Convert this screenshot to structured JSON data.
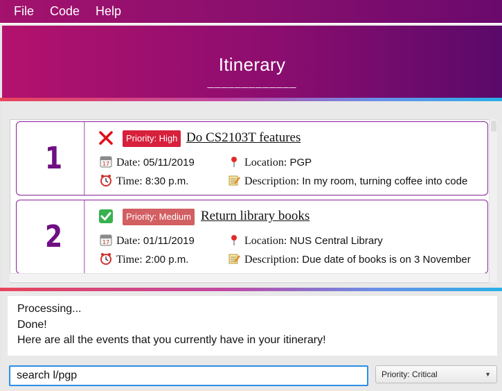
{
  "menu": {
    "file": "File",
    "code": "Code",
    "help": "Help"
  },
  "header": {
    "title": "Itinerary",
    "underline": "_____________"
  },
  "events": [
    {
      "index": "1",
      "status_icon": "cross-icon",
      "priority": "Priority: High",
      "title": "Do CS2103T features",
      "date_label": "Date:",
      "date": "05/11/2019",
      "time_label": "Time:",
      "time": "8:30 p.m.",
      "location_label": "Location:",
      "location": "PGP",
      "description_label": "Description:",
      "description": "In my room, turning coffee into code"
    },
    {
      "index": "2",
      "status_icon": "check-icon",
      "priority": "Priority: Medium",
      "title": "Return library books",
      "date_label": "Date:",
      "date": "01/11/2019",
      "time_label": "Time:",
      "time": "2:00 p.m.",
      "location_label": "Location:",
      "location": "NUS Central Library",
      "description_label": "Description:",
      "description": "Due date of books is on 3 November"
    }
  ],
  "result": {
    "line1": "Processing...",
    "line2": "Done!",
    "line3": "Here are all the events that you currently have in your itinerary!"
  },
  "command": {
    "value": "search l/pgp"
  },
  "priority_select": {
    "selected": "Priority: Critical"
  },
  "colors": {
    "accent_purple": "#8b1f9a",
    "priority_high": "#d7203c",
    "priority_medium": "#d25f62",
    "input_focus": "#2b8ee6"
  }
}
